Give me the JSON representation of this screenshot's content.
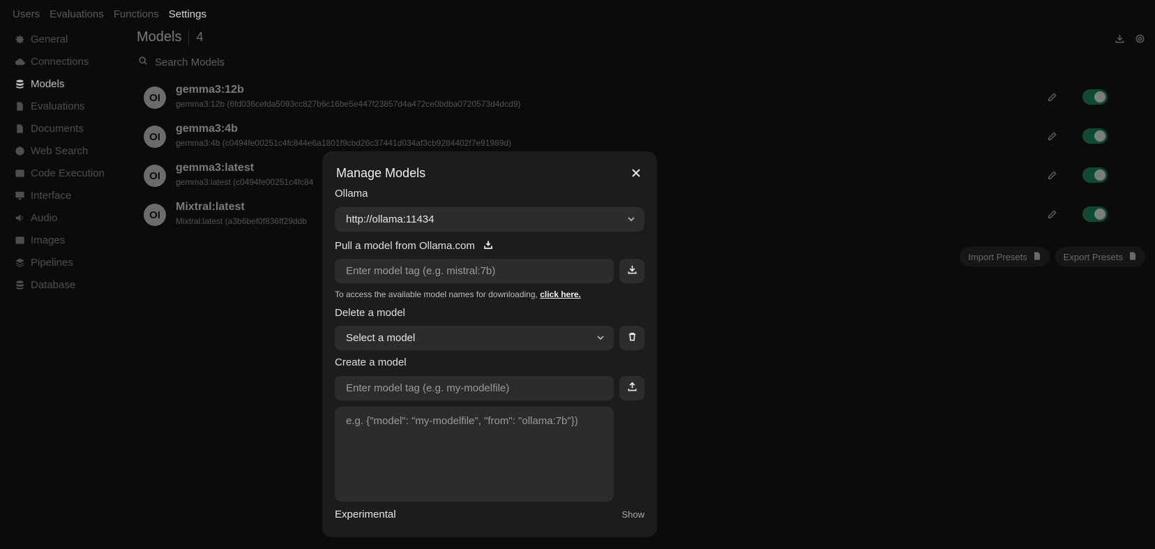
{
  "top_tabs": [
    "Users",
    "Evaluations",
    "Functions",
    "Settings"
  ],
  "sidebar": {
    "items": [
      {
        "label": "General",
        "icon": "gear-icon"
      },
      {
        "label": "Connections",
        "icon": "cloud-icon"
      },
      {
        "label": "Models",
        "icon": "database-icon"
      },
      {
        "label": "Evaluations",
        "icon": "document-icon"
      },
      {
        "label": "Documents",
        "icon": "document-icon"
      },
      {
        "label": "Web Search",
        "icon": "globe-icon"
      },
      {
        "label": "Code Execution",
        "icon": "terminal-icon"
      },
      {
        "label": "Interface",
        "icon": "monitor-icon"
      },
      {
        "label": "Audio",
        "icon": "speaker-icon"
      },
      {
        "label": "Images",
        "icon": "image-icon"
      },
      {
        "label": "Pipelines",
        "icon": "layers-icon"
      },
      {
        "label": "Database",
        "icon": "database-icon"
      }
    ]
  },
  "models_header": {
    "title": "Models",
    "count": "4"
  },
  "search": {
    "placeholder": "Search Models"
  },
  "models": [
    {
      "avatar": "OI",
      "name": "gemma3:12b",
      "desc": "gemma3:12b (6fd036cefda5093cc827b6c16be5e447f23857d4a472ce0bdba0720573d4dcd9)"
    },
    {
      "avatar": "OI",
      "name": "gemma3:4b",
      "desc": "gemma3:4b (c0494fe00251c4fc844e6a1801f9cbd26c37441d034af3cb9284402f7e91989d)"
    },
    {
      "avatar": "OI",
      "name": "gemma3:latest",
      "desc": "gemma3:latest (c0494fe00251c4fc84"
    },
    {
      "avatar": "OI",
      "name": "Mixtral:latest",
      "desc": "Mixtral:latest (a3b6bef0f836ff29ddb"
    }
  ],
  "presets": {
    "import": "Import Presets",
    "export": "Export Presets"
  },
  "modal": {
    "title": "Manage Models",
    "ollama_label": "Ollama",
    "ollama_url": "http://ollama:11434",
    "pull_label": "Pull a model from Ollama.com",
    "pull_placeholder": "Enter model tag (e.g. mistral:7b)",
    "hint_text": "To access the available model names for downloading,",
    "hint_link": "click here.",
    "delete_label": "Delete a model",
    "delete_select": "Select a model",
    "create_label": "Create a model",
    "create_placeholder": "Enter model tag (e.g. my-modelfile)",
    "create_json_placeholder": "e.g. {\"model\": \"my-modelfile\", \"from\": \"ollama:7b\"})",
    "experimental_label": "Experimental",
    "experimental_toggle": "Show"
  },
  "colors": {
    "toggle_on": "#0d4a30",
    "modal_bg": "#1c1c1c",
    "field_bg": "#2c2c2c"
  }
}
